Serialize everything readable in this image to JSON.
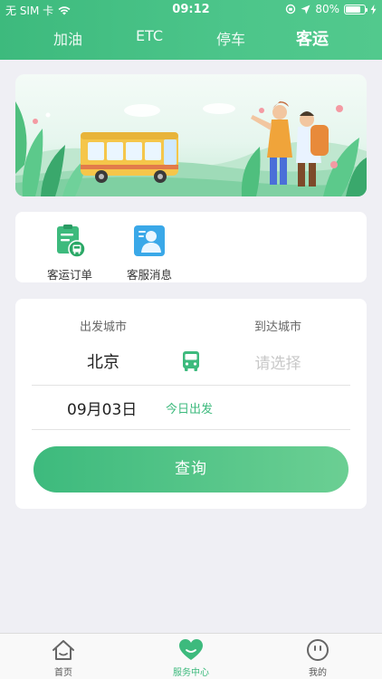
{
  "status_bar": {
    "carrier": "无 SIM 卡",
    "time": "09:12",
    "battery": "80%",
    "icons": [
      "wifi-icon",
      "orientation-lock-icon",
      "location-arrow-icon",
      "battery-icon",
      "charging-icon"
    ]
  },
  "top_tabs": [
    {
      "label": "加油",
      "active": false
    },
    {
      "label": "ETC",
      "active": false
    },
    {
      "label": "停车",
      "active": false
    },
    {
      "label": "客运",
      "active": true
    }
  ],
  "banner": {
    "illustration": "bus-travel-banner"
  },
  "quick_actions": [
    {
      "label": "客运订单",
      "icon": "passenger-order-icon"
    },
    {
      "label": "客服消息",
      "icon": "customer-service-icon"
    }
  ],
  "search_form": {
    "departure_label": "出发城市",
    "departure_value": "北京",
    "arrival_label": "到达城市",
    "arrival_placeholder": "请选择",
    "date": "09月03日",
    "date_note": "今日出发",
    "submit_label": "查询"
  },
  "bottom_nav": [
    {
      "label": "首页",
      "icon": "home-icon",
      "active": false
    },
    {
      "label": "服务中心",
      "icon": "heart-icon",
      "active": true
    },
    {
      "label": "我的",
      "icon": "profile-icon",
      "active": false
    }
  ],
  "colors": {
    "primary": "#3dba7d",
    "background": "#efeff4"
  }
}
